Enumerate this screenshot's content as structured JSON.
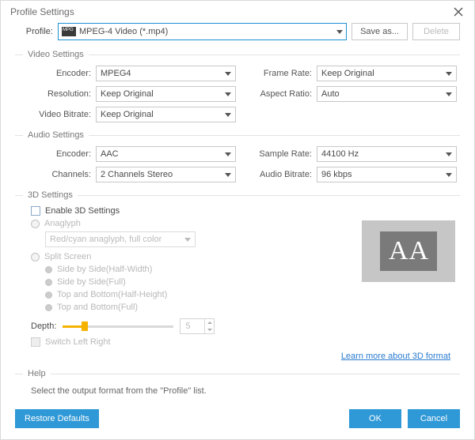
{
  "window": {
    "title": "Profile Settings"
  },
  "profile": {
    "label": "Profile:",
    "selected": "MPEG-4 Video (*.mp4)",
    "save_as_label": "Save as...",
    "delete_label": "Delete"
  },
  "video": {
    "group_title": "Video Settings",
    "encoder_label": "Encoder:",
    "encoder_value": "MPEG4",
    "resolution_label": "Resolution:",
    "resolution_value": "Keep Original",
    "bitrate_label": "Video Bitrate:",
    "bitrate_value": "Keep Original",
    "framerate_label": "Frame Rate:",
    "framerate_value": "Keep Original",
    "aspect_label": "Aspect Ratio:",
    "aspect_value": "Auto"
  },
  "audio": {
    "group_title": "Audio Settings",
    "encoder_label": "Encoder:",
    "encoder_value": "AAC",
    "channels_label": "Channels:",
    "channels_value": "2 Channels Stereo",
    "samplerate_label": "Sample Rate:",
    "samplerate_value": "44100 Hz",
    "bitrate_label": "Audio Bitrate:",
    "bitrate_value": "96 kbps"
  },
  "threeD": {
    "group_title": "3D Settings",
    "enable_label": "Enable 3D Settings",
    "anaglyph_label": "Anaglyph",
    "anaglyph_select": "Red/cyan anaglyph, full color",
    "split_label": "Split Screen",
    "opt1": "Side by Side(Half-Width)",
    "opt2": "Side by Side(Full)",
    "opt3": "Top and Bottom(Half-Height)",
    "opt4": "Top and Bottom(Full)",
    "depth_label": "Depth:",
    "depth_value": "5",
    "switch_label": "Switch Left Right",
    "link_text": "Learn more about 3D format",
    "preview_a": "A",
    "preview_a2": "A"
  },
  "help": {
    "group_title": "Help",
    "text": "Select the output format from the \"Profile\" list."
  },
  "footer": {
    "restore_label": "Restore Defaults",
    "ok_label": "OK",
    "cancel_label": "Cancel"
  }
}
